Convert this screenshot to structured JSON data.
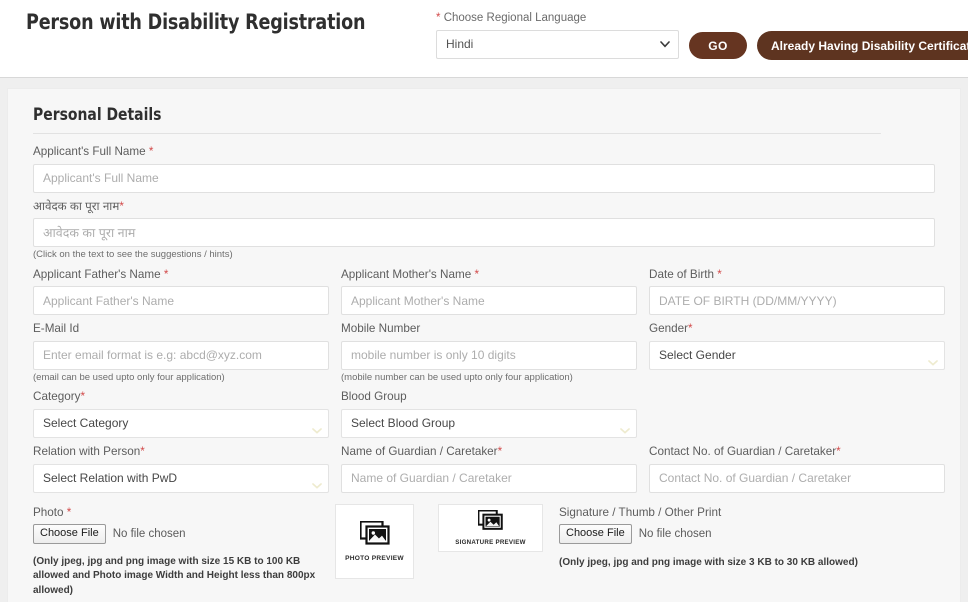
{
  "header": {
    "page_title": "Person with Disability Registration",
    "language_label": "Choose Regional Language",
    "language_required_mark": "*",
    "language_selected": "Hindi",
    "language_options": [
      "Hindi"
    ],
    "go_button": "GO",
    "certificate_button": "Already Having Disability Certificate",
    "go_button_color": "#663521",
    "certificate_button_color": "#5E3420",
    "required_mark_color": "#D24A4A"
  },
  "section": {
    "title": "Personal Details"
  },
  "fields": {
    "full_name": {
      "label": "Applicant's Full Name",
      "required": "*",
      "placeholder": "Applicant's Full Name",
      "value": ""
    },
    "full_name_hindi": {
      "label": "आवेदक का पूरा नाम",
      "required": "*",
      "placeholder": "आवेदक का पूरा नाम",
      "value": "",
      "hint": "(Click on the text to see the suggestions / hints)"
    },
    "father_name": {
      "label": "Applicant Father's Name",
      "required": "*",
      "placeholder": "Applicant Father's Name",
      "value": ""
    },
    "mother_name": {
      "label": "Applicant Mother's Name",
      "required": "*",
      "placeholder": "Applicant Mother's Name",
      "value": ""
    },
    "date_of_birth": {
      "label": "Date of Birth",
      "required": "*",
      "placeholder": "DATE OF BIRTH (DD/MM/YYYY)",
      "value": ""
    },
    "email": {
      "label": "E-Mail Id",
      "required": "",
      "placeholder": "Enter email format is e.g: abcd@xyz.com",
      "value": "",
      "hint": "(email can be used upto only four application)"
    },
    "mobile": {
      "label": "Mobile Number",
      "required": "",
      "placeholder": "mobile number is only 10 digits",
      "value": "",
      "hint": "(mobile number can be used upto only four application)"
    },
    "gender": {
      "label": "Gender",
      "required": "*",
      "selected": "Select Gender",
      "options": [
        "Select Gender"
      ]
    },
    "category": {
      "label": "Category",
      "required": "*",
      "selected": "Select Category",
      "options": [
        "Select Category"
      ]
    },
    "blood_group": {
      "label": "Blood Group",
      "required": "",
      "selected": "Select Blood Group",
      "options": [
        "Select Blood Group"
      ]
    },
    "relation_with_person": {
      "label": "Relation with Person",
      "required": "*",
      "selected": "Select Relation with PwD",
      "options": [
        "Select Relation with PwD"
      ]
    },
    "guardian_name": {
      "label": "Name of Guardian / Caretaker",
      "required": "*",
      "placeholder": "Name of Guardian / Caretaker",
      "value": ""
    },
    "guardian_contact": {
      "label": "Contact No. of Guardian / Caretaker",
      "required": "*",
      "placeholder": "Contact No. of Guardian / Caretaker",
      "value": ""
    }
  },
  "uploads": {
    "photo": {
      "label": "Photo",
      "required": "*",
      "choose_button": "Choose File",
      "file_status": "No file chosen",
      "note": "(Only jpeg, jpg and png image with size 15 KB to 100 KB allowed and Photo image Width and Height less than 800px allowed)",
      "preview_caption": "PHOTO PREVIEW"
    },
    "signature": {
      "label": "Signature / Thumb / Other Print",
      "required": "",
      "choose_button": "Choose File",
      "file_status": "No file chosen",
      "note": "(Only jpeg, jpg and png image with size 3 KB to 30 KB allowed)",
      "preview_caption": "SIGNATURE PREVIEW"
    }
  }
}
